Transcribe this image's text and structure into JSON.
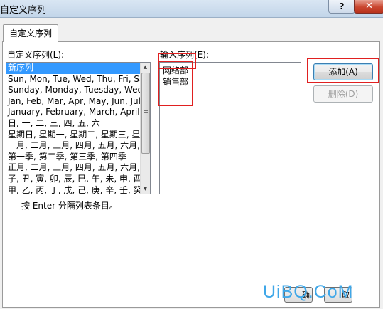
{
  "window": {
    "title": "自定义序列",
    "help_glyph": "?",
    "close_glyph": "✕"
  },
  "tabs": [
    {
      "label": "自定义序列",
      "active": true
    }
  ],
  "custom_lists": {
    "label": "自定义序列(L):",
    "items": [
      "新序列",
      "Sun, Mon, Tue, Wed, Thu, Fri, Sat",
      "Sunday, Monday, Tuesday, Wednesday",
      "Jan, Feb, Mar, Apr, May, Jun, Jul",
      "January, February, March, April",
      "日, 一, 二, 三, 四, 五, 六",
      "星期日, 星期一, 星期二, 星期三, 星期",
      "一月, 二月, 三月, 四月, 五月, 六月, 七",
      "第一季, 第二季, 第三季, 第四季",
      "正月, 二月, 三月, 四月, 五月, 六月, 七",
      "子, 丑, 寅, 卯, 辰, 巳, 午, 未, 申, 酉",
      "甲, 乙, 丙, 丁, 戊, 己, 庚, 辛, 壬, 癸"
    ],
    "selected_index": 0
  },
  "entries": {
    "label": "输入序列(E):",
    "lines": [
      "网络部",
      "销售部"
    ]
  },
  "buttons": {
    "add": "添加(A)",
    "delete": "删除(D)",
    "ok_partial": "确",
    "cancel_partial": "取"
  },
  "hint": "按 Enter 分隔列表条目。",
  "watermark": "UiBQ.CoM",
  "colors": {
    "highlight": "#e02020",
    "selection": "#3399ff",
    "watermark": "#3fa7e8"
  }
}
